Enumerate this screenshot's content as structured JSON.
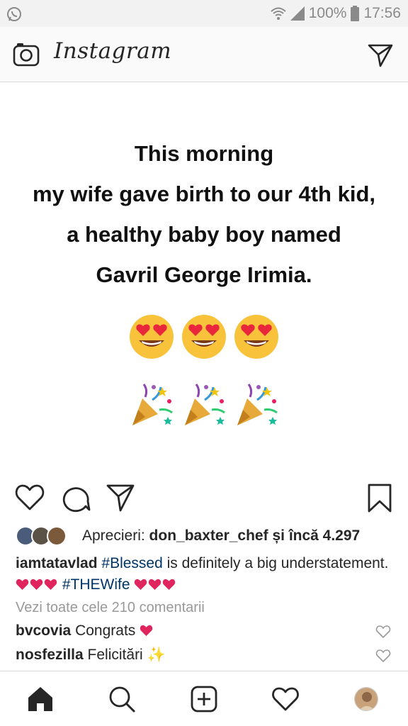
{
  "status_bar": {
    "left_icon": "whatsapp-icon",
    "wifi_icon": "wifi-icon",
    "signal_icon": "signal-icon",
    "battery": "100%",
    "battery_icon": "battery-icon",
    "time": "17:56"
  },
  "header": {
    "left_icon": "camera-icon",
    "title": "Instagram",
    "right_icon": "direct-message-icon"
  },
  "post": {
    "text_lines": [
      "This morning",
      "my wife gave birth to our 4th kid,",
      "a healthy baby boy named",
      "Gavril George Irimia."
    ],
    "emoji_row_1": [
      "heart-eyes-emoji",
      "heart-eyes-emoji",
      "heart-eyes-emoji"
    ],
    "emoji_row_2": [
      "party-popper-emoji",
      "party-popper-emoji",
      "party-popper-emoji"
    ]
  },
  "actions": {
    "icons": [
      "heart-icon",
      "comment-icon",
      "share-icon",
      "bookmark-icon"
    ]
  },
  "likes": {
    "prefix": "Aprecieri:",
    "user": "don_baxter_chef",
    "connector": "și",
    "rest": "încă 4.297"
  },
  "caption": {
    "user": "iamtatavlad",
    "tag_1": "#Blessed",
    "text_1": " is definitely a big understatement. ",
    "tag_2": "#THEWife"
  },
  "view_all_comments": "Vezi toate cele 210 comentarii",
  "comments": [
    {
      "user": "bvcovia",
      "text": "Congrats"
    },
    {
      "user": "nosfezilla",
      "text": "Felicitări ✨"
    }
  ],
  "bottom_nav": {
    "icons": [
      "home-icon",
      "search-icon",
      "add-post-icon",
      "activity-heart-icon",
      "profile-avatar"
    ]
  },
  "colors": {
    "status_bar_bg": "#f2f2f2",
    "header_bg": "#fafafa",
    "hashtag": "#003569",
    "heart_red": "#e0245e",
    "muted_text": "#999999"
  }
}
